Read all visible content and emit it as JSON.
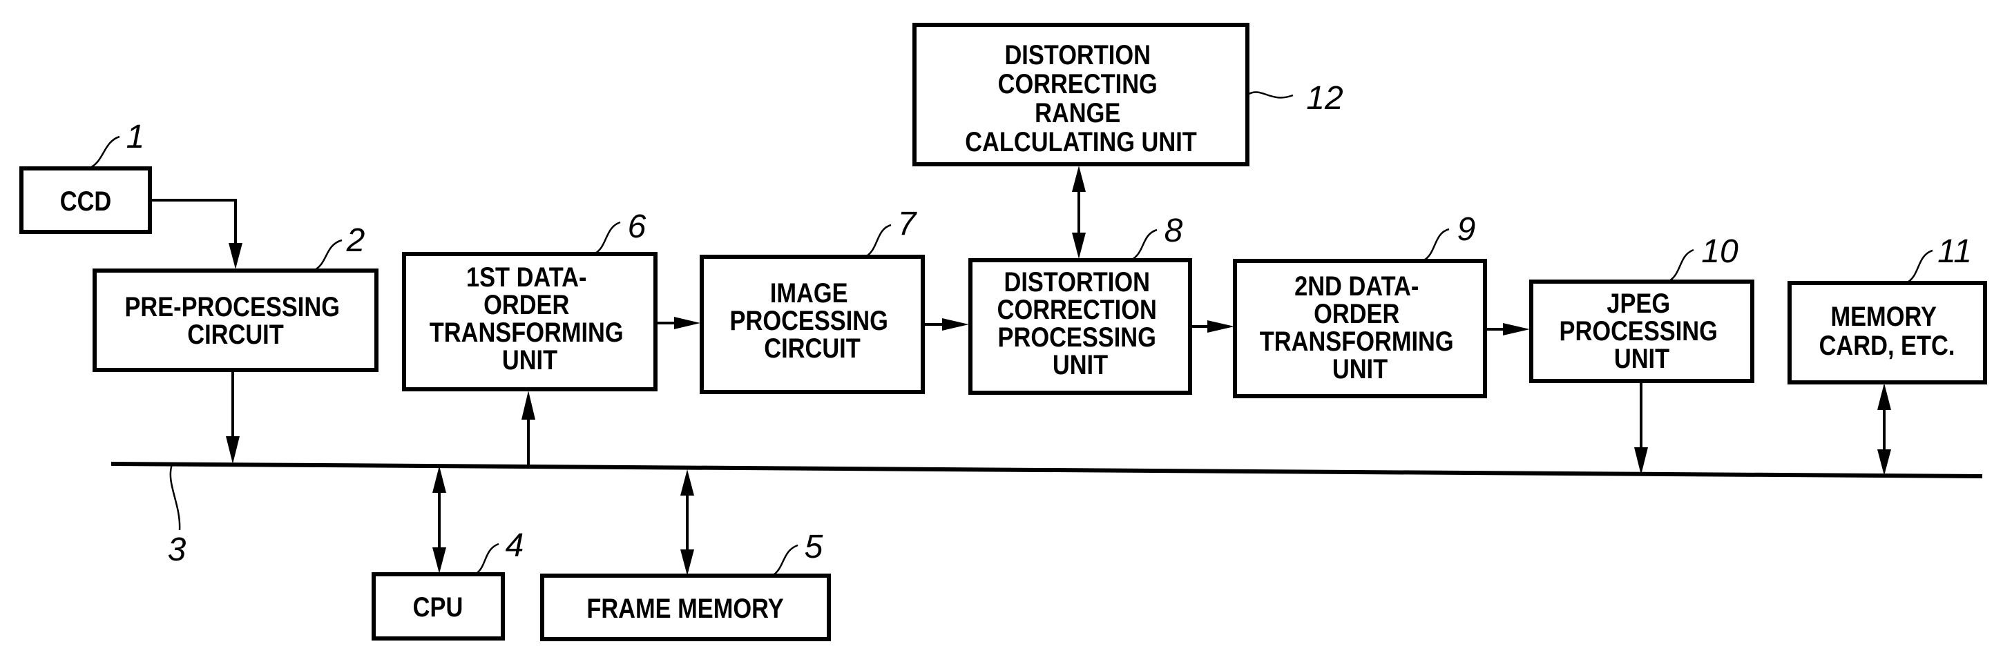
{
  "figure": {
    "blocks": {
      "ccd": {
        "ref": "1",
        "lines": [
          "CCD"
        ]
      },
      "pre_processing": {
        "ref": "2",
        "lines": [
          "PRE-PROCESSING",
          "CIRCUIT"
        ]
      },
      "bus": {
        "ref": "3"
      },
      "cpu": {
        "ref": "4",
        "lines": [
          "CPU"
        ]
      },
      "frame_memory": {
        "ref": "5",
        "lines": [
          "FRAME MEMORY"
        ]
      },
      "first_data_order": {
        "ref": "6",
        "lines": [
          "1ST DATA-",
          "ORDER",
          "TRANSFORMING",
          "UNIT"
        ]
      },
      "image_processing": {
        "ref": "7",
        "lines": [
          "IMAGE",
          "PROCESSING",
          "CIRCUIT"
        ]
      },
      "distortion_correction": {
        "ref": "8",
        "lines": [
          "DISTORTION",
          "CORRECTION",
          "PROCESSING",
          "UNIT"
        ]
      },
      "second_data_order": {
        "ref": "9",
        "lines": [
          "2ND DATA-",
          "ORDER",
          "TRANSFORMING",
          "UNIT"
        ]
      },
      "jpeg": {
        "ref": "10",
        "lines": [
          "JPEG",
          "PROCESSING",
          "UNIT"
        ]
      },
      "memory_card": {
        "ref": "11",
        "lines": [
          "MEMORY",
          "CARD, ETC."
        ]
      },
      "range_calc": {
        "ref": "12",
        "lines": [
          "DISTORTION",
          "CORRECTING",
          "RANGE",
          "CALCULATING UNIT"
        ]
      }
    },
    "connections": [
      {
        "from": "CCD",
        "to": "PRE-PROCESSING CIRCUIT",
        "type": "one-way"
      },
      {
        "from": "PRE-PROCESSING CIRCUIT",
        "to": "BUS",
        "type": "one-way"
      },
      {
        "from": "BUS",
        "to": "1ST DATA-ORDER TRANSFORMING UNIT",
        "type": "one-way"
      },
      {
        "from": "1ST DATA-ORDER TRANSFORMING UNIT",
        "to": "IMAGE PROCESSING CIRCUIT",
        "type": "one-way"
      },
      {
        "from": "IMAGE PROCESSING CIRCUIT",
        "to": "DISTORTION CORRECTION PROCESSING UNIT",
        "type": "one-way"
      },
      {
        "from": "DISTORTION CORRECTION PROCESSING UNIT",
        "to": "DISTORTION CORRECTING RANGE CALCULATING UNIT",
        "type": "two-way"
      },
      {
        "from": "DISTORTION CORRECTION PROCESSING UNIT",
        "to": "2ND DATA-ORDER TRANSFORMING UNIT",
        "type": "one-way"
      },
      {
        "from": "2ND DATA-ORDER TRANSFORMING UNIT",
        "to": "JPEG PROCESSING UNIT",
        "type": "one-way"
      },
      {
        "from": "JPEG PROCESSING UNIT",
        "to": "BUS",
        "type": "one-way"
      },
      {
        "from": "MEMORY CARD, ETC.",
        "to": "BUS",
        "type": "two-way"
      },
      {
        "from": "CPU",
        "to": "BUS",
        "type": "two-way"
      },
      {
        "from": "FRAME MEMORY",
        "to": "BUS",
        "type": "two-way"
      }
    ]
  }
}
